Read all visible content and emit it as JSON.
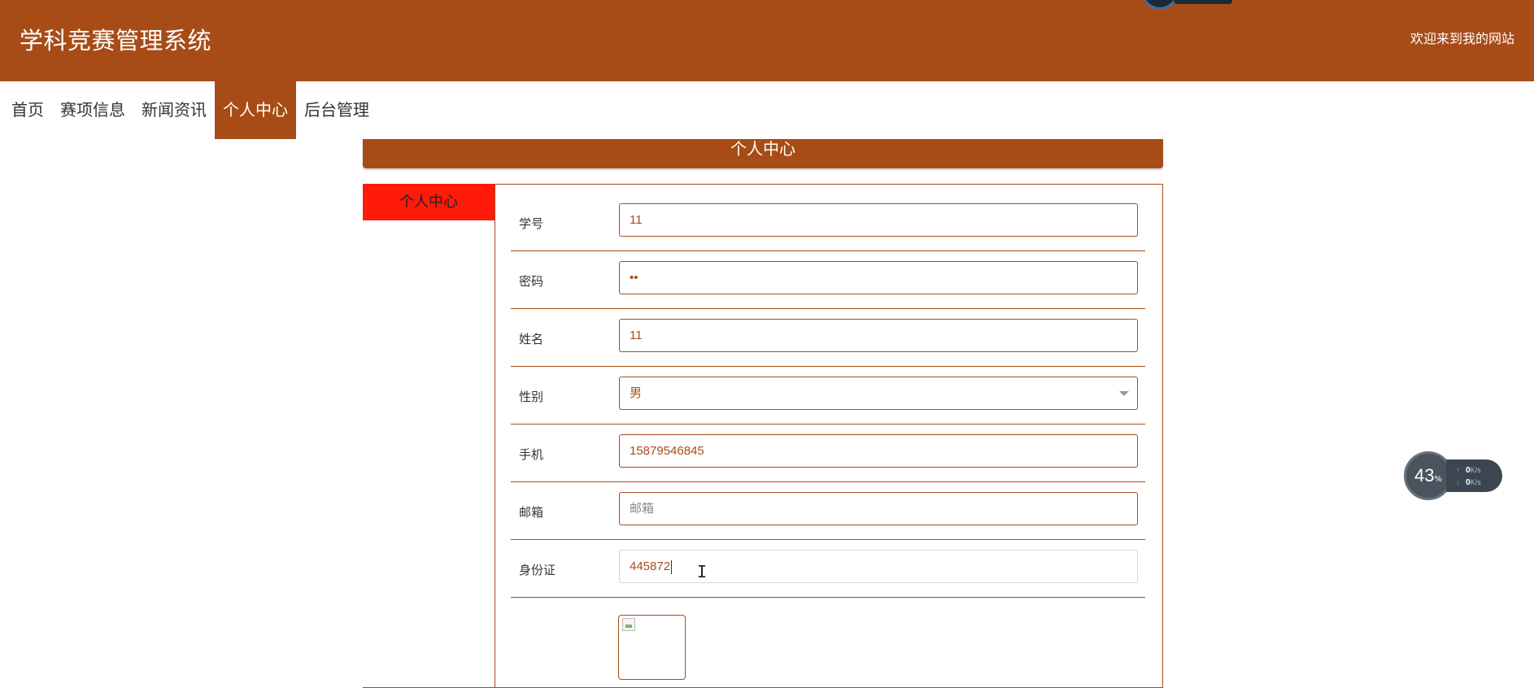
{
  "header": {
    "title": "学科竞赛管理系统",
    "welcome": "欢迎来到我的网站",
    "brand_color": "#a84c17"
  },
  "nav": {
    "items": [
      {
        "label": "首页",
        "active": false
      },
      {
        "label": "赛项信息",
        "active": false
      },
      {
        "label": "新闻资讯",
        "active": false
      },
      {
        "label": "个人中心",
        "active": true
      },
      {
        "label": "后台管理",
        "active": false
      }
    ]
  },
  "panel": {
    "title": "个人中心",
    "side_menu_item": "个人中心",
    "side_menu_color": "#ff1a0a"
  },
  "form": {
    "student_id": {
      "label": "学号",
      "value": "11"
    },
    "password": {
      "label": "密码",
      "value": "••"
    },
    "name": {
      "label": "姓名",
      "value": "11"
    },
    "gender": {
      "label": "性别",
      "value": "男"
    },
    "phone": {
      "label": "手机",
      "value": "15879546845"
    },
    "email": {
      "label": "邮箱",
      "value": "",
      "placeholder": "邮箱"
    },
    "id_card": {
      "label": "身份证",
      "value": "445872"
    },
    "avatar": {
      "label": ""
    }
  },
  "speed_widget": {
    "percent": "43",
    "percent_unit": "%",
    "upload": "0",
    "download": "0",
    "unit": "K/s"
  }
}
